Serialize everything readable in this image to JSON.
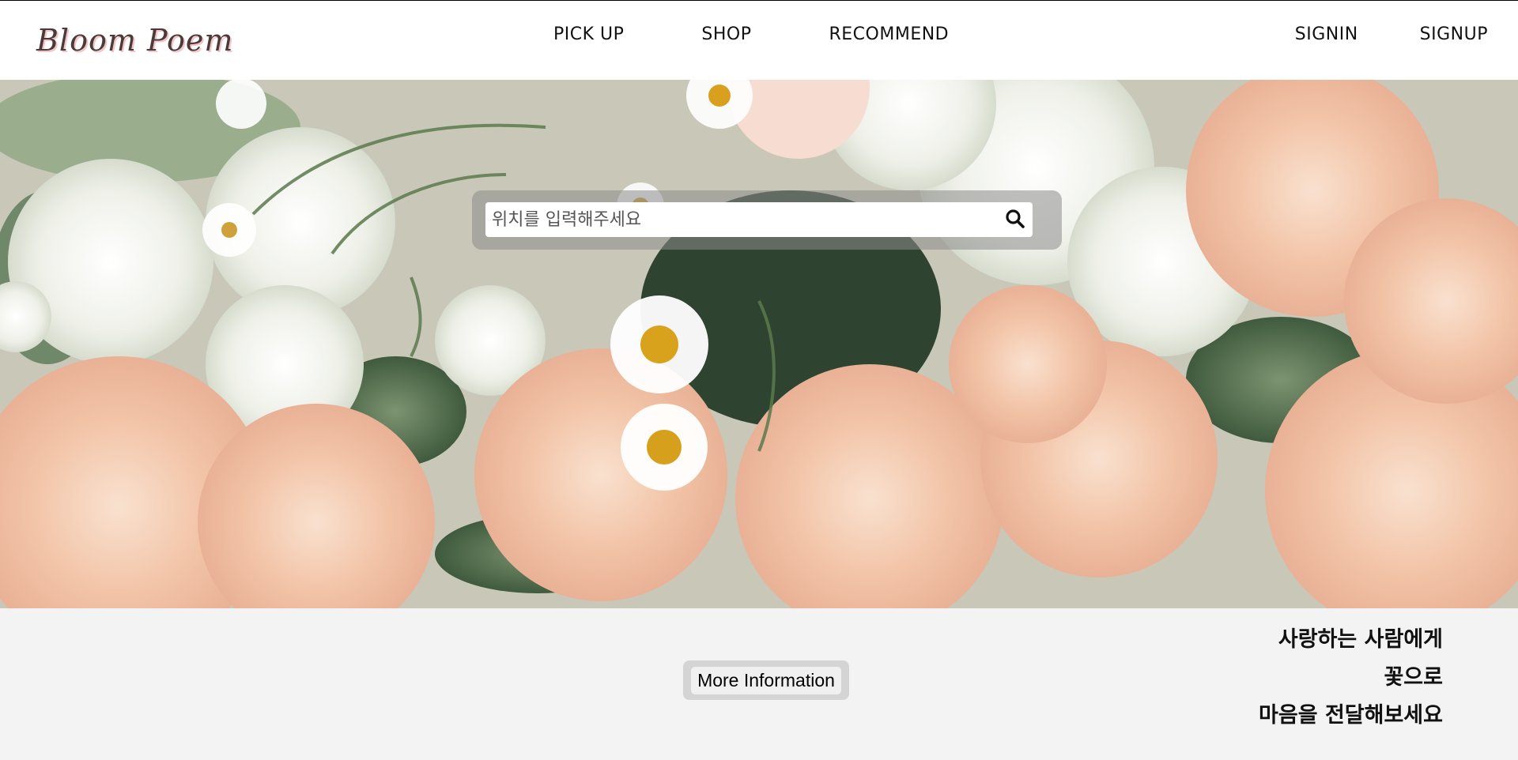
{
  "brand": {
    "name": "Bloom Poem",
    "accent": "#f1a7b1"
  },
  "nav": {
    "items": [
      {
        "label": "PICK UP"
      },
      {
        "label": "SHOP"
      },
      {
        "label": "RECOMMEND"
      }
    ]
  },
  "auth": {
    "signin": "SIGNIN",
    "signup": "SIGNUP"
  },
  "hero": {
    "search": {
      "placeholder": "위치를 입력해주세요",
      "value": "",
      "icon": "search-icon"
    }
  },
  "panel": {
    "more_button": "More Information",
    "tagline": [
      "사랑하는 사람에게",
      "꽃으로",
      "마음을 전달해보세요"
    ],
    "background": "#f3f3f3"
  }
}
